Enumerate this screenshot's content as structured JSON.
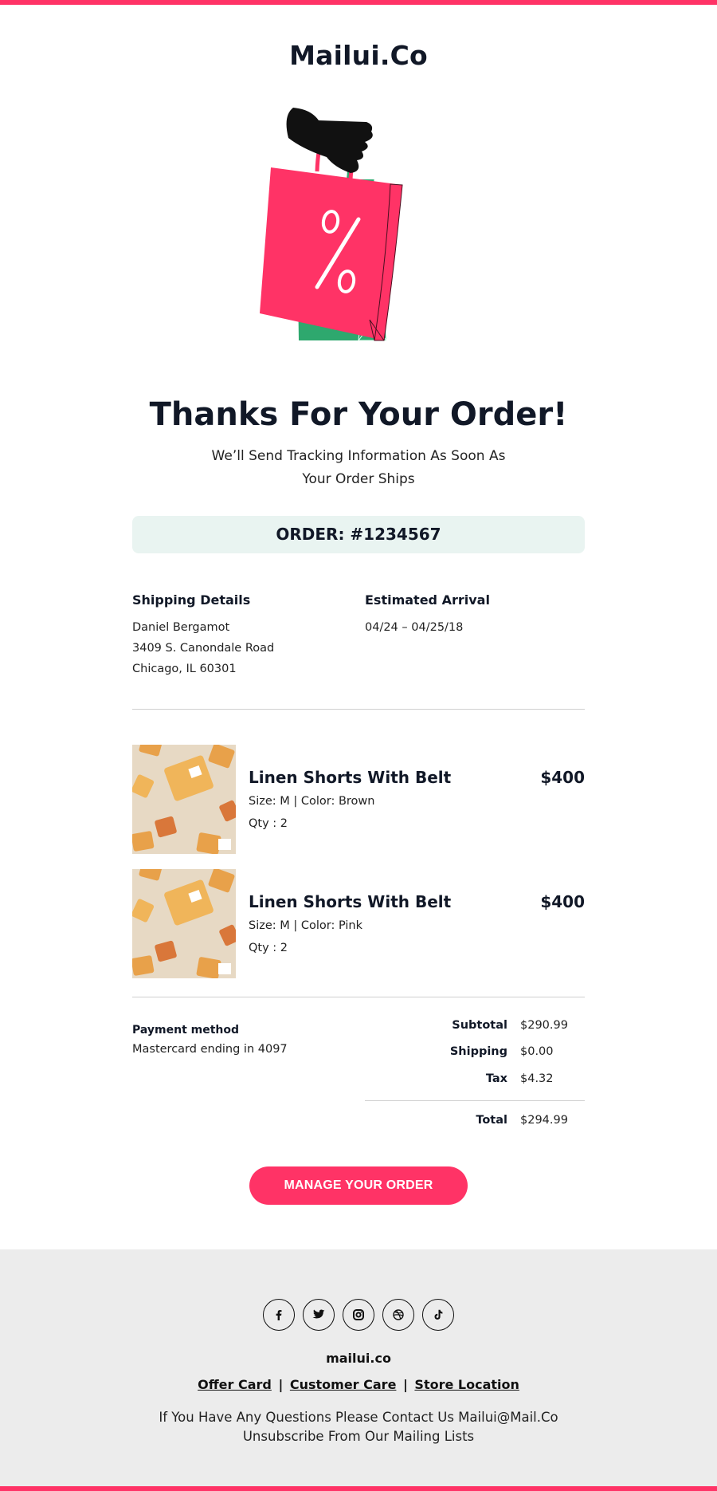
{
  "brand": {
    "logo_text": "Mailui.Co",
    "accent_color": "#ff3366",
    "order_box_color": "#e9f4f1",
    "bag_green": "#2ea86e"
  },
  "hero": {
    "icon": "shopping-bags-illustration"
  },
  "header": {
    "title": "Thanks For Your Order!",
    "subtitle": "We’ll Send Tracking Information As Soon As Your Order Ships"
  },
  "order": {
    "number_label": "ORDER: #1234567"
  },
  "shipping": {
    "heading": "Shipping Details",
    "lines": [
      "Daniel Bergamot",
      "3409 S. Canondale Road",
      "Chicago, IL 60301"
    ]
  },
  "arrival": {
    "heading": "Estimated Arrival",
    "dates": "04/24 – 04/25/18"
  },
  "products": [
    {
      "name": "Linen Shorts With Belt",
      "price": "$400",
      "details": "Size: M | Color: Brown",
      "qty": "Qty : 2",
      "image_icon": "wallet-pattern-image"
    },
    {
      "name": "Linen Shorts With Belt",
      "price": "$400",
      "details": "Size: M | Color: Pink",
      "qty": "Qty : 2",
      "image_icon": "wallet-pattern-image"
    }
  ],
  "payment": {
    "label": "Payment method",
    "value": "Mastercard ending in 4097"
  },
  "summary": {
    "subtotal_label": "Subtotal",
    "subtotal_value": "$290.99",
    "shipping_label": "Shipping",
    "shipping_value": "$0.00",
    "tax_label": "Tax",
    "tax_value": "$4.32",
    "total_label": "Total",
    "total_value": "$294.99"
  },
  "cta": {
    "label": "MANAGE YOUR ORDER"
  },
  "footer": {
    "socials": [
      "facebook-icon",
      "twitter-icon",
      "instagram-icon",
      "dribbble-icon",
      "tiktok-icon"
    ],
    "domain": "mailui.co",
    "links": [
      "Offer Card",
      "Customer Care",
      "Store Location"
    ],
    "separator": "|",
    "contact": "If You Have Any Questions Please Contact Us Mailui@Mail.Co",
    "unsubscribe": "Unsubscribe From Our Mailing Lists"
  }
}
